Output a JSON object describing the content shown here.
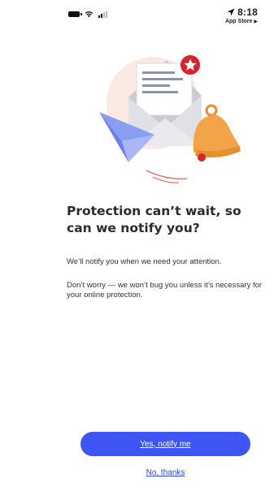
{
  "status_bar": {
    "time": "8:18",
    "back_app": "App Store",
    "icons": [
      "battery-icon",
      "wifi-icon",
      "signal-icon",
      "location-icon"
    ]
  },
  "illustration": {
    "name": "notification-illustration",
    "elements": [
      "envelope",
      "star-badge",
      "paper-plane",
      "bell"
    ]
  },
  "content": {
    "headline": "Protection can’t wait, so can we notify you?",
    "body_1": "We’ll notify you when we need your attention.",
    "body_2": "Don’t worry — we won’t bug you unless it’s necessary for your online protection."
  },
  "actions": {
    "primary_label": "Yes, notify me",
    "secondary_label": "No, thanks"
  },
  "colors": {
    "primary": "#3d55f2",
    "link": "#2b47d6",
    "badge": "#d8232a",
    "bell": "#f4a448",
    "plane": "#7d8ff0"
  }
}
